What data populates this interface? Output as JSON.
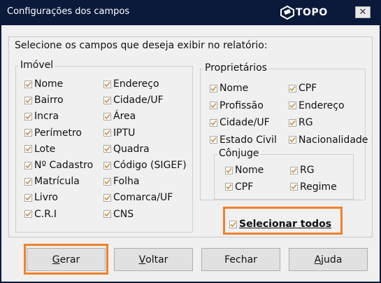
{
  "window": {
    "title": "Configurações dos campos",
    "brand": "TOPO",
    "close_glyph": "✕"
  },
  "prompt": "Selecione os campos que deseja exibir no relatório:",
  "imovel": {
    "legend": "Imóvel",
    "col1": [
      {
        "label": "Nome",
        "checked": true
      },
      {
        "label": "Bairro",
        "checked": true
      },
      {
        "label": "Incra",
        "checked": true
      },
      {
        "label": "Perímetro",
        "checked": true
      },
      {
        "label": "Lote",
        "checked": true
      },
      {
        "label": "Nº Cadastro",
        "checked": true
      },
      {
        "label": "Matrícula",
        "checked": true
      },
      {
        "label": "Livro",
        "checked": true
      },
      {
        "label": "C.R.I",
        "checked": true
      }
    ],
    "col2": [
      {
        "label": "Endereço",
        "checked": true
      },
      {
        "label": "Cidade/UF",
        "checked": true
      },
      {
        "label": "Área",
        "checked": true
      },
      {
        "label": "IPTU",
        "checked": true
      },
      {
        "label": "Quadra",
        "checked": true
      },
      {
        "label": "Código (SIGEF)",
        "checked": true
      },
      {
        "label": "Folha",
        "checked": true
      },
      {
        "label": "Comarca/UF",
        "checked": true
      },
      {
        "label": "CNS",
        "checked": true
      }
    ]
  },
  "proprietarios": {
    "legend": "Proprietários",
    "col1": [
      {
        "label": "Nome",
        "checked": true
      },
      {
        "label": "Profissão",
        "checked": true
      },
      {
        "label": "Cidade/UF",
        "checked": true
      },
      {
        "label": "Estado Civil",
        "checked": true
      }
    ],
    "col2": [
      {
        "label": "CPF",
        "checked": true
      },
      {
        "label": "Endereço",
        "checked": true
      },
      {
        "label": "RG",
        "checked": true
      },
      {
        "label": "Nacionalidade",
        "checked": true
      }
    ]
  },
  "conjuge": {
    "legend": "Cônjuge",
    "col1": [
      {
        "label": "Nome",
        "checked": true
      },
      {
        "label": "CPF",
        "checked": true
      }
    ],
    "col2": [
      {
        "label": "RG",
        "checked": true
      },
      {
        "label": "Regime",
        "checked": true
      }
    ]
  },
  "select_all": {
    "label": "Selecionar todos",
    "checked": true
  },
  "buttons": {
    "gerar": {
      "first": "G",
      "rest": "erar"
    },
    "voltar": {
      "first": "V",
      "rest": "oltar"
    },
    "fechar": {
      "label": "Fechar"
    },
    "ajuda": {
      "first": "A",
      "rest": "juda"
    }
  },
  "colors": {
    "titlebar": "#0b1a3b",
    "highlight": "#f0812a",
    "checkmark": "#d08a3a"
  }
}
